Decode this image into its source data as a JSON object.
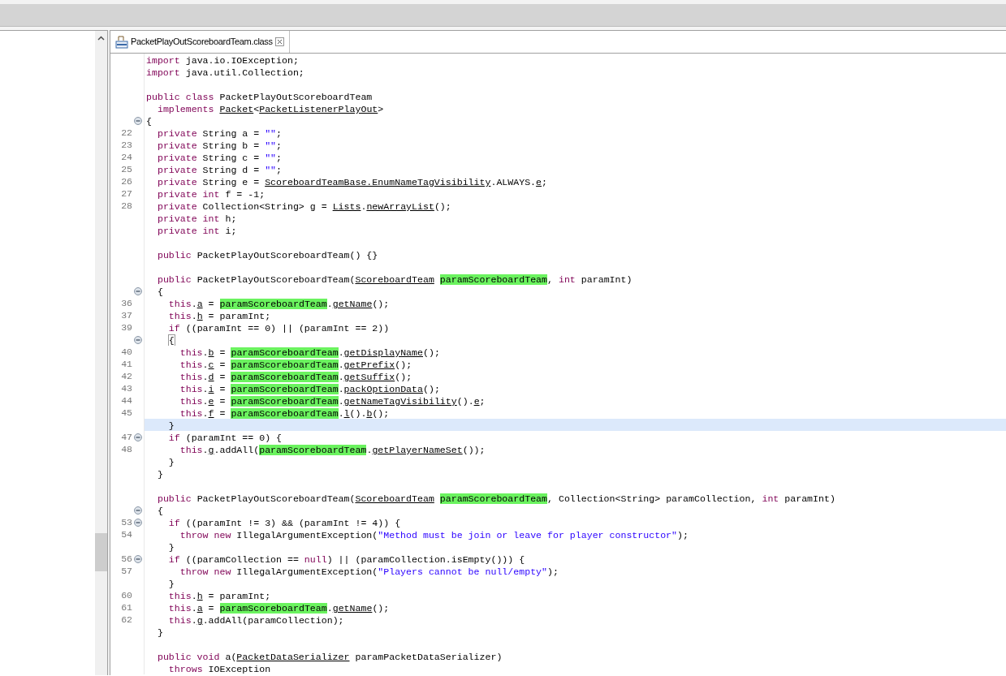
{
  "tab": {
    "label": "PacketPlayOutScoreboardTeam.class",
    "selected": true
  },
  "lines": [
    {
      "current": false,
      "segs": [
        {
          "kind": "kw",
          "text": "import"
        },
        {
          "kind": "p",
          "text": " java.io.IOException;"
        }
      ]
    },
    {
      "current": false,
      "segs": [
        {
          "kind": "kw",
          "text": "import"
        },
        {
          "kind": "p",
          "text": " java.util.Collection;"
        }
      ]
    },
    {
      "current": false
    },
    {
      "current": false,
      "segs": [
        {
          "kind": "kw",
          "text": "public class"
        },
        {
          "kind": "p",
          "text": " PacketPlayOutScoreboardTeam"
        }
      ]
    },
    {
      "current": false,
      "segs": [
        {
          "kind": "kw",
          "text": "  implements"
        },
        {
          "kind": "ref",
          "text": " Packet"
        },
        {
          "kind": "p",
          "text": "<"
        },
        {
          "kind": "ref",
          "text": "PacketListenerPlayOut"
        },
        {
          "kind": "p",
          "text": ">"
        }
      ]
    },
    {
      "current": false,
      "fold": true,
      "segs": [
        {
          "kind": "p",
          "text": "{"
        }
      ]
    },
    {
      "current": false,
      "n": "22",
      "segs": [
        {
          "kind": "kw",
          "text": "  private"
        },
        {
          "kind": "p",
          "text": " String a = "
        },
        {
          "kind": "str",
          "text": "\"\""
        },
        {
          "kind": "p",
          "text": ";"
        }
      ]
    },
    {
      "current": false,
      "n": "23",
      "segs": [
        {
          "kind": "kw",
          "text": "  private"
        },
        {
          "kind": "p",
          "text": " String b = "
        },
        {
          "kind": "str",
          "text": "\"\""
        },
        {
          "kind": "p",
          "text": ";"
        }
      ]
    },
    {
      "current": false,
      "n": "24",
      "segs": [
        {
          "kind": "kw",
          "text": "  private"
        },
        {
          "kind": "p",
          "text": " String c = "
        },
        {
          "kind": "str",
          "text": "\"\""
        },
        {
          "kind": "p",
          "text": ";"
        }
      ]
    },
    {
      "current": false,
      "n": "25",
      "segs": [
        {
          "kind": "kw",
          "text": "  private"
        },
        {
          "kind": "p",
          "text": " String d = "
        },
        {
          "kind": "str",
          "text": "\"\""
        },
        {
          "kind": "p",
          "text": ";"
        }
      ]
    },
    {
      "current": false,
      "n": "26",
      "segs": [
        {
          "kind": "kw",
          "text": "  private"
        },
        {
          "kind": "p",
          "text": " String e = "
        },
        {
          "kind": "ref",
          "text": "ScoreboardTeamBase.EnumNameTagVisibility"
        },
        {
          "kind": "p",
          "text": ".ALWAYS."
        },
        {
          "kind": "ref",
          "text": "e"
        },
        {
          "kind": "p",
          "text": ";"
        }
      ]
    },
    {
      "current": false,
      "n": "27",
      "segs": [
        {
          "kind": "kw",
          "text": "  private int"
        },
        {
          "kind": "p",
          "text": " f = -1;"
        }
      ]
    },
    {
      "current": false,
      "n": "28",
      "segs": [
        {
          "kind": "kw",
          "text": "  private"
        },
        {
          "kind": "p",
          "text": " Collection<String> g = "
        },
        {
          "kind": "ref",
          "text": "Lists"
        },
        {
          "kind": "p",
          "text": "."
        },
        {
          "kind": "ref",
          "text": "newArrayList"
        },
        {
          "kind": "p",
          "text": "();"
        }
      ]
    },
    {
      "current": false,
      "segs": [
        {
          "kind": "kw",
          "text": "  private int"
        },
        {
          "kind": "p",
          "text": " h;"
        }
      ]
    },
    {
      "current": false,
      "segs": [
        {
          "kind": "kw",
          "text": "  private int"
        },
        {
          "kind": "p",
          "text": " i;"
        }
      ]
    },
    {
      "current": false
    },
    {
      "current": false,
      "segs": [
        {
          "kind": "kw",
          "text": "  public"
        },
        {
          "kind": "p",
          "text": " PacketPlayOutScoreboardTeam() {}"
        }
      ]
    },
    {
      "current": false
    },
    {
      "current": false,
      "segs": [
        {
          "kind": "kw",
          "text": "  public"
        },
        {
          "kind": "p",
          "text": " PacketPlayOutScoreboardTeam("
        },
        {
          "kind": "ref",
          "text": "ScoreboardTeam"
        },
        {
          "kind": "hl",
          "text": " paramScoreboardTeam"
        },
        {
          "kind": "p",
          "text": ", "
        },
        {
          "kind": "kw",
          "text": "int"
        },
        {
          "kind": "p",
          "text": " paramInt)"
        }
      ]
    },
    {
      "current": false,
      "fold": true,
      "segs": [
        {
          "kind": "p",
          "text": "  {"
        }
      ]
    },
    {
      "current": false,
      "n": "36",
      "segs": [
        {
          "kind": "kw",
          "text": "    this"
        },
        {
          "kind": "p",
          "text": "."
        },
        {
          "kind": "ref",
          "text": "a"
        },
        {
          "kind": "p",
          "text": " = "
        },
        {
          "kind": "hl",
          "text": "paramScoreboardTeam"
        },
        {
          "kind": "p",
          "text": "."
        },
        {
          "kind": "ref",
          "text": "getName"
        },
        {
          "kind": "p",
          "text": "();"
        }
      ]
    },
    {
      "current": false,
      "n": "37",
      "segs": [
        {
          "kind": "kw",
          "text": "    this"
        },
        {
          "kind": "p",
          "text": "."
        },
        {
          "kind": "ref",
          "text": "h"
        },
        {
          "kind": "p",
          "text": " = paramInt;"
        }
      ]
    },
    {
      "current": false,
      "n": "39",
      "segs": [
        {
          "kind": "kw",
          "text": "    if"
        },
        {
          "kind": "p",
          "text": " ((paramInt == 0) || (paramInt == 2))"
        }
      ]
    },
    {
      "current": false,
      "fold": true,
      "segs": [
        {
          "kind": "match",
          "text": "    {"
        }
      ]
    },
    {
      "current": false,
      "n": "40",
      "segs": [
        {
          "kind": "kw",
          "text": "      this"
        },
        {
          "kind": "p",
          "text": "."
        },
        {
          "kind": "ref",
          "text": "b"
        },
        {
          "kind": "p",
          "text": " = "
        },
        {
          "kind": "hl",
          "text": "paramScoreboardTeam"
        },
        {
          "kind": "p",
          "text": "."
        },
        {
          "kind": "ref",
          "text": "getDisplayName"
        },
        {
          "kind": "p",
          "text": "();"
        }
      ]
    },
    {
      "current": false,
      "n": "41",
      "segs": [
        {
          "kind": "kw",
          "text": "      this"
        },
        {
          "kind": "p",
          "text": "."
        },
        {
          "kind": "ref",
          "text": "c"
        },
        {
          "kind": "p",
          "text": " = "
        },
        {
          "kind": "hl",
          "text": "paramScoreboardTeam"
        },
        {
          "kind": "p",
          "text": "."
        },
        {
          "kind": "ref",
          "text": "getPrefix"
        },
        {
          "kind": "p",
          "text": "();"
        }
      ]
    },
    {
      "current": false,
      "n": "42",
      "segs": [
        {
          "kind": "kw",
          "text": "      this"
        },
        {
          "kind": "p",
          "text": "."
        },
        {
          "kind": "ref",
          "text": "d"
        },
        {
          "kind": "p",
          "text": " = "
        },
        {
          "kind": "hl",
          "text": "paramScoreboardTeam"
        },
        {
          "kind": "p",
          "text": "."
        },
        {
          "kind": "ref",
          "text": "getSuffix"
        },
        {
          "kind": "p",
          "text": "();"
        }
      ]
    },
    {
      "current": false,
      "n": "43",
      "segs": [
        {
          "kind": "kw",
          "text": "      this"
        },
        {
          "kind": "p",
          "text": "."
        },
        {
          "kind": "ref",
          "text": "i"
        },
        {
          "kind": "p",
          "text": " = "
        },
        {
          "kind": "hl",
          "text": "paramScoreboardTeam"
        },
        {
          "kind": "p",
          "text": "."
        },
        {
          "kind": "ref",
          "text": "packOptionData"
        },
        {
          "kind": "p",
          "text": "();"
        }
      ]
    },
    {
      "current": false,
      "n": "44",
      "segs": [
        {
          "kind": "kw",
          "text": "      this"
        },
        {
          "kind": "p",
          "text": "."
        },
        {
          "kind": "ref",
          "text": "e"
        },
        {
          "kind": "p",
          "text": " = "
        },
        {
          "kind": "hl",
          "text": "paramScoreboardTeam"
        },
        {
          "kind": "p",
          "text": "."
        },
        {
          "kind": "ref",
          "text": "getNameTagVisibility"
        },
        {
          "kind": "p",
          "text": "()."
        },
        {
          "kind": "ref",
          "text": "e"
        },
        {
          "kind": "p",
          "text": ";"
        }
      ]
    },
    {
      "current": false,
      "n": "45",
      "segs": [
        {
          "kind": "kw",
          "text": "      this"
        },
        {
          "kind": "p",
          "text": "."
        },
        {
          "kind": "ref",
          "text": "f"
        },
        {
          "kind": "p",
          "text": " = "
        },
        {
          "kind": "hl",
          "text": "paramScoreboardTeam"
        },
        {
          "kind": "p",
          "text": "."
        },
        {
          "kind": "ref",
          "text": "l"
        },
        {
          "kind": "p",
          "text": "()."
        },
        {
          "kind": "ref",
          "text": "b"
        },
        {
          "kind": "p",
          "text": "();"
        }
      ]
    },
    {
      "current": true,
      "segs": [
        {
          "kind": "p",
          "text": "    }"
        }
      ]
    },
    {
      "current": false,
      "n": "47",
      "fold": true,
      "segs": [
        {
          "kind": "kw",
          "text": "    if"
        },
        {
          "kind": "p",
          "text": " (paramInt == 0) {"
        }
      ]
    },
    {
      "current": false,
      "n": "48",
      "segs": [
        {
          "kind": "kw",
          "text": "      this"
        },
        {
          "kind": "p",
          "text": "."
        },
        {
          "kind": "ref",
          "text": "g"
        },
        {
          "kind": "p",
          "text": ".addAll("
        },
        {
          "kind": "hl",
          "text": "paramScoreboardTeam"
        },
        {
          "kind": "p",
          "text": "."
        },
        {
          "kind": "ref",
          "text": "getPlayerNameSet"
        },
        {
          "kind": "p",
          "text": "());"
        }
      ]
    },
    {
      "current": false,
      "segs": [
        {
          "kind": "p",
          "text": "    }"
        }
      ]
    },
    {
      "current": false,
      "segs": [
        {
          "kind": "p",
          "text": "  }"
        }
      ]
    },
    {
      "current": false
    },
    {
      "current": false,
      "segs": [
        {
          "kind": "kw",
          "text": "  public"
        },
        {
          "kind": "p",
          "text": " PacketPlayOutScoreboardTeam("
        },
        {
          "kind": "ref",
          "text": "ScoreboardTeam"
        },
        {
          "kind": "hl",
          "text": " paramScoreboardTeam"
        },
        {
          "kind": "p",
          "text": ", Collection<String> paramCollection, "
        },
        {
          "kind": "kw",
          "text": "int"
        },
        {
          "kind": "p",
          "text": " paramInt)"
        }
      ]
    },
    {
      "current": false,
      "fold": true,
      "segs": [
        {
          "kind": "p",
          "text": "  {"
        }
      ]
    },
    {
      "current": false,
      "n": "53",
      "fold": true,
      "segs": [
        {
          "kind": "kw",
          "text": "    if"
        },
        {
          "kind": "p",
          "text": " ((paramInt != 3) && (paramInt != 4)) {"
        }
      ]
    },
    {
      "current": false,
      "n": "54",
      "segs": [
        {
          "kind": "kw",
          "text": "      throw new"
        },
        {
          "kind": "p",
          "text": " IllegalArgumentException("
        },
        {
          "kind": "str",
          "text": "\"Method must be join or leave for player constructor\""
        },
        {
          "kind": "p",
          "text": ");"
        }
      ]
    },
    {
      "current": false,
      "segs": [
        {
          "kind": "p",
          "text": "    }"
        }
      ]
    },
    {
      "current": false,
      "n": "56",
      "fold": true,
      "segs": [
        {
          "kind": "kw",
          "text": "    if"
        },
        {
          "kind": "p",
          "text": " ((paramCollection == "
        },
        {
          "kind": "kw",
          "text": "null"
        },
        {
          "kind": "p",
          "text": ") || (paramCollection.isEmpty())) {"
        }
      ]
    },
    {
      "current": false,
      "n": "57",
      "segs": [
        {
          "kind": "kw",
          "text": "      throw new"
        },
        {
          "kind": "p",
          "text": " IllegalArgumentException("
        },
        {
          "kind": "str",
          "text": "\"Players cannot be null/empty\""
        },
        {
          "kind": "p",
          "text": ");"
        }
      ]
    },
    {
      "current": false,
      "segs": [
        {
          "kind": "p",
          "text": "    }"
        }
      ]
    },
    {
      "current": false,
      "n": "60",
      "segs": [
        {
          "kind": "kw",
          "text": "    this"
        },
        {
          "kind": "p",
          "text": "."
        },
        {
          "kind": "ref",
          "text": "h"
        },
        {
          "kind": "p",
          "text": " = paramInt;"
        }
      ]
    },
    {
      "current": false,
      "n": "61",
      "segs": [
        {
          "kind": "kw",
          "text": "    this"
        },
        {
          "kind": "p",
          "text": "."
        },
        {
          "kind": "ref",
          "text": "a"
        },
        {
          "kind": "p",
          "text": " = "
        },
        {
          "kind": "hl",
          "text": "paramScoreboardTeam"
        },
        {
          "kind": "p",
          "text": "."
        },
        {
          "kind": "ref",
          "text": "getName"
        },
        {
          "kind": "p",
          "text": "();"
        }
      ]
    },
    {
      "current": false,
      "n": "62",
      "segs": [
        {
          "kind": "kw",
          "text": "    this"
        },
        {
          "kind": "p",
          "text": "."
        },
        {
          "kind": "ref",
          "text": "g"
        },
        {
          "kind": "p",
          "text": ".addAll(paramCollection);"
        }
      ]
    },
    {
      "current": false,
      "segs": [
        {
          "kind": "p",
          "text": "  }"
        }
      ]
    },
    {
      "current": false
    },
    {
      "current": false,
      "segs": [
        {
          "kind": "kw",
          "text": "  public void"
        },
        {
          "kind": "p",
          "text": " a("
        },
        {
          "kind": "ref",
          "text": "PacketDataSerializer"
        },
        {
          "kind": "p",
          "text": " paramPacketDataSerializer)"
        }
      ]
    },
    {
      "current": false,
      "segs": [
        {
          "kind": "kw",
          "text": "    throws"
        },
        {
          "kind": "p",
          "text": " IOException"
        }
      ]
    }
  ]
}
